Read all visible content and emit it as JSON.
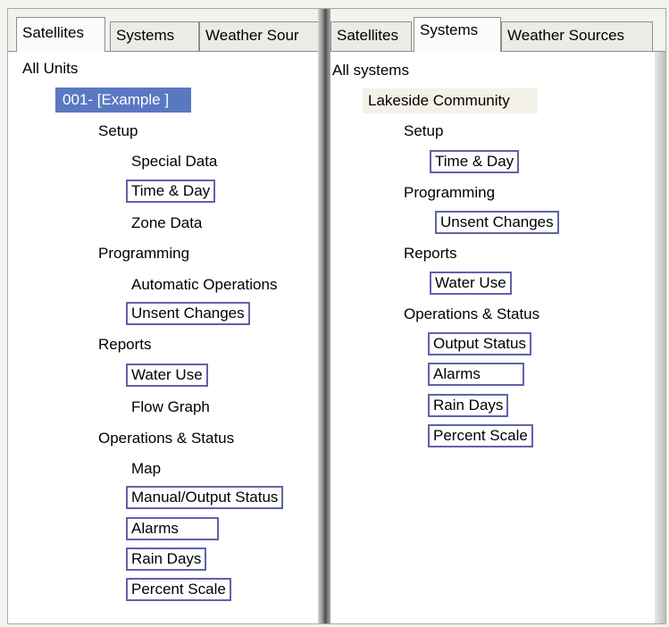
{
  "left": {
    "tabs": [
      "Satellites",
      "Systems",
      "Weather Sour"
    ],
    "root": "All Units",
    "unit": "001- [Example ]",
    "setup": "Setup",
    "special_data": "Special Data",
    "time_day": "Time & Day",
    "zone_data": "Zone Data",
    "programming": "Programming",
    "automatic_operations": "Automatic Operations",
    "unsent_changes": "Unsent Changes",
    "reports": "Reports",
    "water_use": "Water Use",
    "flow_graph": "Flow Graph",
    "operations_status": "Operations & Status",
    "map": "Map",
    "manual_output_status": "Manual/Output Status",
    "alarms": "Alarms",
    "rain_days": "Rain Days",
    "percent_scale": "Percent Scale"
  },
  "right": {
    "tabs": [
      "Satellites",
      "Systems",
      "Weather Sources"
    ],
    "root": "All systems",
    "community": "Lakeside Community",
    "setup": "Setup",
    "time_day": "Time & Day",
    "programming": "Programming",
    "unsent_changes": "Unsent Changes",
    "reports": "Reports",
    "water_use": "Water Use",
    "operations_status": "Operations & Status",
    "output_status": "Output Status",
    "alarms": "Alarms",
    "rain_days": "Rain Days",
    "percent_scale": "Percent Scale"
  },
  "colors": {
    "selection": "#5a78c2",
    "box_border": "#5e63a8",
    "tree_bg": "#ffffff"
  }
}
